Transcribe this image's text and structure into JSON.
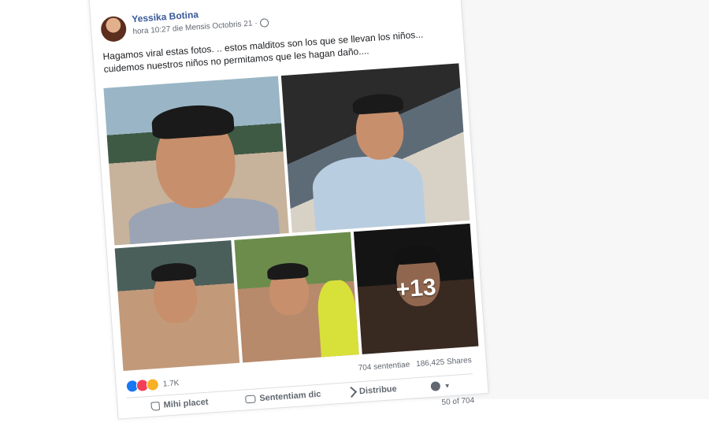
{
  "post": {
    "author": "Yessika Botina",
    "timestamp": "hora 10:27 die Mensis Octobris 21",
    "separator": "·",
    "text": "Hagamos viral estas fotos. .. estos malditos son los que se llevan los niños... cuidemos nuestros niños no permitamos que les hagan daño....",
    "more_photos": "+13"
  },
  "stats": {
    "reactions_count": "1.7K",
    "comments": "704 sententiae",
    "shares": "186,425 Shares"
  },
  "actions": {
    "like": "Mihi placet",
    "comment": "Sententiam dic",
    "share": "Distribue"
  },
  "pager": "50 of 704",
  "icons": [
    "globe-icon",
    "like-reaction-icon",
    "love-reaction-icon",
    "wow-reaction-icon",
    "like-icon",
    "comment-icon",
    "share-icon",
    "audience-icon"
  ],
  "colors": {
    "author_link": "#385898",
    "like": "#1877f2",
    "love": "#f33e58",
    "wow": "#f7b125"
  }
}
